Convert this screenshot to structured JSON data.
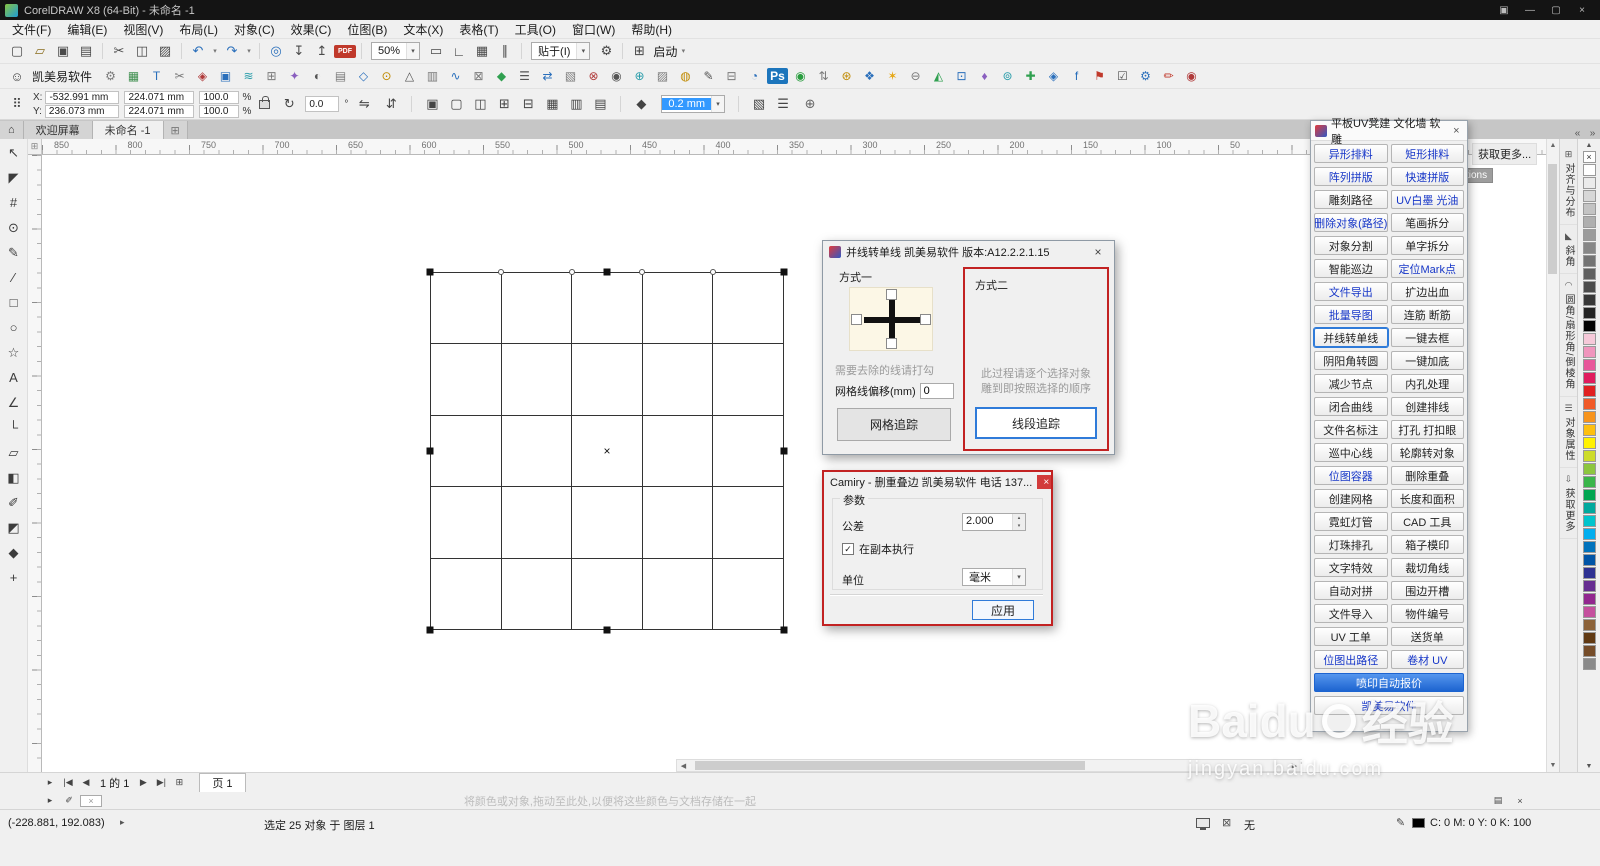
{
  "ui": {
    "dropdown_arrow": "▾",
    "spin_up": "▴",
    "spin_down": "▾",
    "percent": "%",
    "degree": "°",
    "check_glyph": "✓"
  },
  "titlebar": {
    "title": "CorelDRAW X8 (64-Bit) - 未命名 -1",
    "tray_glyph": "▣",
    "min_glyph": "—",
    "max_glyph": "▢",
    "close_glyph": "×"
  },
  "menu_bar": {
    "items": [
      "文件(F)",
      "编辑(E)",
      "视图(V)",
      "布局(L)",
      "对象(C)",
      "效果(C)",
      "位图(B)",
      "文本(X)",
      "表格(T)",
      "工具(O)",
      "窗口(W)",
      "帮助(H)"
    ]
  },
  "toolbar_main": {
    "left_icons": [
      {
        "n": "new-document-icon",
        "g": "▢",
        "c": "#4a4a4a"
      },
      {
        "n": "open-icon",
        "g": "▱",
        "c": "#8a6d1d"
      },
      {
        "n": "save-icon",
        "g": "▣",
        "c": "#4a4a4a"
      },
      {
        "n": "print-icon",
        "g": "▤",
        "c": "#4a4a4a"
      },
      {
        "sep": true
      },
      {
        "n": "cut-icon",
        "g": "✂",
        "c": "#4a4a4a"
      },
      {
        "n": "copy-icon",
        "g": "◫",
        "c": "#4a4a4a"
      },
      {
        "n": "paste-icon",
        "g": "▨",
        "c": "#4a4a4a"
      },
      {
        "sep": true
      },
      {
        "n": "undo-icon",
        "g": "↶",
        "c": "#2a6fbb",
        "dd": true
      },
      {
        "n": "redo-icon",
        "g": "↷",
        "c": "#2a6fbb",
        "dd": true
      },
      {
        "sep": true
      },
      {
        "n": "search-content-icon",
        "g": "◎",
        "c": "#2a6fbb"
      },
      {
        "n": "import-icon",
        "g": "↧",
        "c": "#4a4a4a"
      },
      {
        "n": "export-icon",
        "g": "↥",
        "c": "#4a4a4a"
      },
      {
        "n": "pdf-icon",
        "g": "PDF",
        "c": "#ffffff",
        "badge": "#c0392b"
      },
      {
        "sep": true
      }
    ],
    "zoom_value": "50%",
    "mid_icons": [
      {
        "n": "fullscreen-preview-icon",
        "g": "▭",
        "c": "#4a4a4a"
      },
      {
        "n": "show-rulers-icon",
        "g": "∟",
        "c": "#4a4a4a"
      },
      {
        "n": "show-grid-icon",
        "g": "▦",
        "c": "#4a4a4a"
      },
      {
        "n": "show-guidelines-icon",
        "g": "∥",
        "c": "#4a4a4a"
      },
      {
        "sep": true
      }
    ],
    "snap_label": "贴于(I)",
    "gear_glyph": "⚙",
    "launch_icon_glyph": "⊞",
    "launch_label": "启动"
  },
  "toolbar_plugin": {
    "label": "凯美易软件",
    "icons": [
      {
        "g": "⚙",
        "c": "#7a7a7a"
      },
      {
        "g": "▦",
        "c": "#3f8f4f"
      },
      {
        "g": "T",
        "c": "#2a6fbb"
      },
      {
        "g": "✂",
        "c": "#7a7a7a"
      },
      {
        "g": "◈",
        "c": "#b03a3a"
      },
      {
        "g": "▣",
        "c": "#2a6fbb"
      },
      {
        "g": "≋",
        "c": "#2a9daa"
      },
      {
        "g": "⊞",
        "c": "#7a7a7a"
      },
      {
        "g": "✦",
        "c": "#8a5fbf"
      },
      {
        "g": "◐",
        "c": "#555555"
      },
      {
        "g": "▤",
        "c": "#7a7a7a"
      },
      {
        "g": "◇",
        "c": "#2a6fbb"
      },
      {
        "g": "⊙",
        "c": "#c08a00"
      },
      {
        "g": "△",
        "c": "#555555"
      },
      {
        "g": "▥",
        "c": "#7a7a7a"
      },
      {
        "g": "∿",
        "c": "#2a6fbb"
      },
      {
        "g": "⊠",
        "c": "#7a7a7a"
      },
      {
        "g": "◆",
        "c": "#30a050"
      },
      {
        "g": "☰",
        "c": "#555555"
      },
      {
        "g": "⇄",
        "c": "#2a6fbb"
      },
      {
        "g": "▧",
        "c": "#7a7a7a"
      },
      {
        "g": "⊗",
        "c": "#b03a3a"
      },
      {
        "g": "◉",
        "c": "#555555"
      },
      {
        "g": "⊕",
        "c": "#2a9daa"
      },
      {
        "g": "▨",
        "c": "#7a7a7a"
      },
      {
        "g": "◍",
        "c": "#c08a00"
      },
      {
        "g": "✎",
        "c": "#555555"
      },
      {
        "g": "⊟",
        "c": "#7a7a7a"
      },
      {
        "g": "◔",
        "c": "#2a6fbb"
      },
      {
        "g": "Ps",
        "c": "#1c75bc",
        "badge": true
      },
      {
        "g": "◉",
        "c": "#2a9d3f"
      },
      {
        "g": "⇅",
        "c": "#7a7a7a"
      },
      {
        "g": "⊛",
        "c": "#c08a00"
      },
      {
        "g": "❖",
        "c": "#2a6fbb"
      },
      {
        "g": "✶",
        "c": "#e6a817"
      },
      {
        "g": "⊖",
        "c": "#7a7a7a"
      },
      {
        "g": "◭",
        "c": "#30a050"
      },
      {
        "g": "⊡",
        "c": "#2a6fbb"
      },
      {
        "g": "♦",
        "c": "#8a5fbf"
      },
      {
        "g": "⊚",
        "c": "#2a9daa"
      },
      {
        "g": "✚",
        "c": "#30a050"
      },
      {
        "g": "◈",
        "c": "#2a6fbb"
      },
      {
        "g": "f",
        "c": "#2a6fbb"
      },
      {
        "g": "⚑",
        "c": "#c0392b"
      },
      {
        "g": "☑",
        "c": "#555555"
      },
      {
        "g": "⚙",
        "c": "#2a6fbb"
      },
      {
        "g": "✏",
        "c": "#c0392b"
      },
      {
        "g": "◉",
        "c": "#b03a3a"
      }
    ]
  },
  "property_bar": {
    "position_grid_glyph": "⠿",
    "x_label": "X:",
    "x_value": "-532.991 mm",
    "y_label": "Y:",
    "y_value": "236.073 mm",
    "width_value": "224.071 mm",
    "height_value": "224.071 mm",
    "scale_x": "100.0",
    "scale_y": "100.0",
    "rotate_glyph": "↻",
    "rotation_value": "0.0",
    "mirror_h_glyph": "⇋",
    "mirror_v_glyph": "⇵",
    "outline_icon_glyph": "◆",
    "outline_width_value": "0.2 mm",
    "quick_customize_glyph": "⊕",
    "object_icons": [
      {
        "n": "group-objects-icon",
        "g": "▣"
      },
      {
        "n": "ungroup-icon",
        "g": "▢"
      },
      {
        "n": "ungroup-all-icon",
        "g": "◫"
      },
      {
        "n": "combine-icon",
        "g": "⊞"
      },
      {
        "n": "break-apart-icon",
        "g": "⊟"
      },
      {
        "n": "align-distribute-icon",
        "g": "▦"
      },
      {
        "n": "order-icon",
        "g": "▥"
      },
      {
        "n": "convert-curves-icon",
        "g": "▤"
      }
    ],
    "trailing_icons": [
      {
        "n": "text-wrap-icon",
        "g": "▧"
      },
      {
        "n": "alignment-icon",
        "g": "☰"
      }
    ]
  },
  "document_tabs": {
    "home_glyph": "⌂",
    "tabs": [
      "欢迎屏幕",
      "未命名 -1"
    ],
    "active_index": 1,
    "new_tab_glyph": "⊞",
    "collapse_left": "«",
    "collapse_right": "»"
  },
  "ruler": {
    "origin_glyph": "⊞",
    "h_numbers": [
      "850",
      "800",
      "750",
      "700",
      "650",
      "600",
      "550",
      "500",
      "450",
      "400",
      "350",
      "300",
      "250",
      "200",
      "150",
      "100",
      "50"
    ]
  },
  "toolbox": {
    "tools": [
      {
        "n": "pick-tool",
        "g": "↖"
      },
      {
        "n": "shape-tool",
        "g": "◤"
      },
      {
        "n": "crop-tool",
        "g": "#"
      },
      {
        "n": "zoom-tool",
        "g": "⊙"
      },
      {
        "n": "freehand-tool",
        "g": "✎"
      },
      {
        "n": "two-point-line-tool",
        "g": "∕"
      },
      {
        "n": "rectangle-tool",
        "g": "□"
      },
      {
        "n": "ellipse-tool",
        "g": "○"
      },
      {
        "n": "polygon-tool",
        "g": "☆"
      },
      {
        "n": "text-tool",
        "g": "A"
      },
      {
        "n": "dimension-tool",
        "g": "∠"
      },
      {
        "n": "connector-tool",
        "g": "└"
      },
      {
        "n": "drop-shadow-tool",
        "g": "▱"
      },
      {
        "n": "transparency-tool",
        "g": "◧"
      },
      {
        "n": "color-eyedropper-tool",
        "g": "✐"
      },
      {
        "n": "interactive-fill-tool",
        "g": "◩"
      },
      {
        "n": "smart-fill-tool",
        "g": "◆"
      },
      {
        "n": "more-tools-button",
        "g": "+"
      }
    ]
  },
  "canvas": {
    "grid": {
      "rows": 5,
      "cols": 5
    },
    "center_mark": "×"
  },
  "dialog_trace": {
    "title": "并线转单线 凯美易软件 版本:A12.2.2.1.15",
    "close_glyph": "×",
    "method1_label": "方式一",
    "hint1": "需要去除的线请打勾",
    "offset_label": "网格线偏移(mm)",
    "offset_value": "0",
    "grid_trace_button": "网格追踪",
    "method2_label": "方式二",
    "hint2_line1": "此过程请逐个选择对象",
    "hint2_line2": "雕到即按照选择的顺序",
    "line_trace_button": "线段追踪"
  },
  "dialog_camiry": {
    "title": "Camiry - 删重叠边 凯美易软件  电话 137...",
    "close_glyph": "×",
    "params_label": "参数",
    "tolerance_label": "公差",
    "tolerance_value": "2.000",
    "checkbox_label": "在副本执行",
    "unit_label": "单位",
    "unit_value": "毫米",
    "apply_button": "应用"
  },
  "plugin_panel": {
    "title": "平板UV凳建 文化墙 软雕",
    "close_glyph": "×",
    "rows": [
      [
        {
          "l": "异形排料",
          "c": "b"
        },
        {
          "l": "矩形排料",
          "c": "b"
        }
      ],
      [
        {
          "l": "阵列拼版",
          "c": "b"
        },
        {
          "l": "快速拼版",
          "c": "b"
        }
      ],
      [
        {
          "l": "雕刻路径",
          "c": "k"
        },
        {
          "l": "UV白墨 光油",
          "c": "b"
        }
      ],
      [
        {
          "l": "删除对象(路径)",
          "c": "b"
        },
        {
          "l": "笔画拆分",
          "c": "k"
        }
      ],
      [
        {
          "l": "对象分割",
          "c": "k"
        },
        {
          "l": "单字拆分",
          "c": "k"
        }
      ],
      [
        {
          "l": "智能巡边",
          "c": "k"
        },
        {
          "l": "定位Mark点",
          "c": "b"
        }
      ],
      [
        {
          "l": "文件导出",
          "c": "b"
        },
        {
          "l": "扩边出血",
          "c": "k"
        }
      ],
      [
        {
          "l": "批量导图",
          "c": "b"
        },
        {
          "l": "连筋 断筋",
          "c": "k"
        }
      ],
      [
        {
          "l": "并线转单线",
          "c": "k",
          "active": true
        },
        {
          "l": "一键去框",
          "c": "k"
        }
      ],
      [
        {
          "l": "阴阳角转圆",
          "c": "k"
        },
        {
          "l": "一键加底",
          "c": "k"
        }
      ],
      [
        {
          "l": "减少节点",
          "c": "k"
        },
        {
          "l": "内孔处理",
          "c": "k"
        }
      ],
      [
        {
          "l": "闭合曲线",
          "c": "k"
        },
        {
          "l": "创建排线",
          "c": "k"
        }
      ],
      [
        {
          "l": "文件名标注",
          "c": "k"
        },
        {
          "l": "打孔 打扣眼",
          "c": "k"
        }
      ],
      [
        {
          "l": "巡中心线",
          "c": "k"
        },
        {
          "l": "轮廓转对象",
          "c": "k"
        }
      ],
      [
        {
          "l": "位图容器",
          "c": "b"
        },
        {
          "l": "删除重叠",
          "c": "k"
        }
      ],
      [
        {
          "l": "创建网格",
          "c": "k"
        },
        {
          "l": "长度和面积",
          "c": "k"
        }
      ],
      [
        {
          "l": "霓虹灯管",
          "c": "k"
        },
        {
          "l": "CAD 工具",
          "c": "k"
        }
      ],
      [
        {
          "l": "灯珠排孔",
          "c": "k"
        },
        {
          "l": "箱子模印",
          "c": "k"
        }
      ],
      [
        {
          "l": "文字特效",
          "c": "k"
        },
        {
          "l": "裁切角线",
          "c": "k"
        }
      ],
      [
        {
          "l": "自动对拼",
          "c": "k"
        },
        {
          "l": "围边开槽",
          "c": "k"
        }
      ],
      [
        {
          "l": "文件导入",
          "c": "k"
        },
        {
          "l": "物件编号",
          "c": "k"
        }
      ],
      [
        {
          "l": "UV 工单",
          "c": "k"
        },
        {
          "l": "送货单",
          "c": "k"
        }
      ],
      [
        {
          "l": "位图出路径",
          "c": "b"
        },
        {
          "l": "卷材 UV",
          "c": "b"
        }
      ]
    ],
    "wide_button": "喷印自动报价",
    "partial_button": "凯美易软件"
  },
  "docker": {
    "get_more_label": "获取更多...",
    "tooltip_fragment": "tions",
    "tabs": [
      {
        "icon": "⊞",
        "label": "对齐与分布"
      },
      {
        "icon": "◣",
        "label": "斜角"
      },
      {
        "icon": "◠",
        "label": "圆角/扇形角/倒棱角"
      },
      {
        "icon": "☰",
        "label": "对象属性"
      },
      {
        "icon": "⇩",
        "label": "获取更多"
      }
    ]
  },
  "palette": {
    "up_glyph": "▲",
    "down_glyph": "▼",
    "none_glyph": "×",
    "colors": [
      "#ffffff",
      "#ebebeb",
      "#d7d7d7",
      "#c3c3c3",
      "#afafaf",
      "#9b9b9b",
      "#878787",
      "#737373",
      "#5f5f5f",
      "#4b4b4b",
      "#373737",
      "#232323",
      "#000000",
      "#f6c9d9",
      "#f095bd",
      "#e8569a",
      "#e01b5d",
      "#e02020",
      "#f05a28",
      "#f7941d",
      "#fdc00f",
      "#fff200",
      "#cddc29",
      "#8cc63f",
      "#39b54a",
      "#00a651",
      "#00a99d",
      "#00c4cc",
      "#00aeef",
      "#0072bc",
      "#0054a6",
      "#2e3192",
      "#662d91",
      "#92278f",
      "#c4509e",
      "#8c6239",
      "#603913",
      "#754c29",
      "#8a8a8a"
    ]
  },
  "scrollbar": {
    "left": "◀",
    "right": "▶",
    "up": "▲",
    "down": "▼"
  },
  "page_bar": {
    "flyout_glyph": "▸",
    "first_glyph": "|◀",
    "prev_glyph": "◀",
    "info": "1 的 1",
    "next_glyph": "▶",
    "last_glyph": "▶|",
    "add_page_glyph": "⊞",
    "page_tab": "页 1"
  },
  "document_palette": {
    "flyout_glyph": "▸",
    "eyedropper_glyph": "✐",
    "empty_swatch_glyph": "×",
    "hint": "将颜色或对象,拖动至此处,以便将这些颜色与文档存储在一起",
    "menu_glyph": "▤",
    "close_glyph": "×"
  },
  "status_bar": {
    "coords": "(-228.881, 192.083)",
    "flyout_glyph": "▸",
    "selection": "选定 25 对象 于 图层 1",
    "fill_glyph": "⊠",
    "fill_label": "无",
    "pen_glyph": "✎",
    "outline_color_hex": "#000000",
    "outline_color_info": "C: 0 M: 0 Y: 0 K: 100"
  },
  "watermark": {
    "brand": "Baidu",
    "suffix": "经验",
    "url": "jingyan.baidu.com"
  }
}
